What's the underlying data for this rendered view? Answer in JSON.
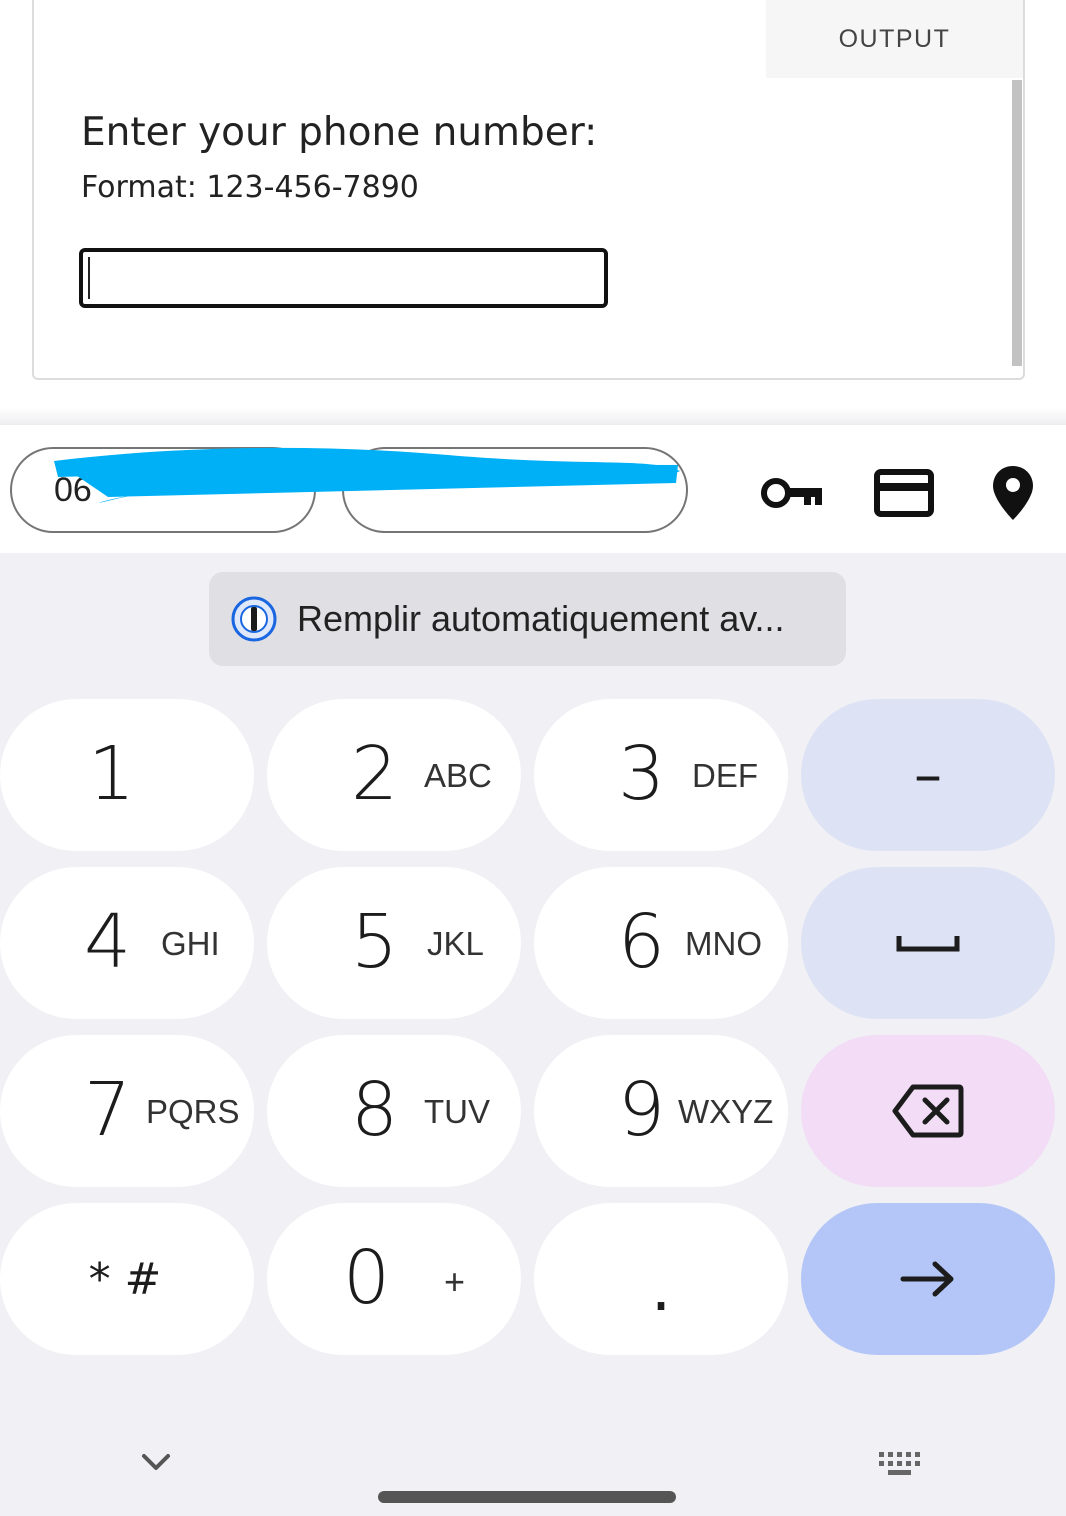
{
  "output": {
    "tab_label": "OUTPUT",
    "prompt": "Enter your phone number:",
    "format_hint": "Format: 123-456-7890",
    "input_value": ""
  },
  "suggestions": {
    "chip_1": "06",
    "chip_2": "",
    "icons": [
      "key-icon",
      "credit-card-icon",
      "location-pin-icon"
    ]
  },
  "autofill": {
    "label": "Remplir automatiquement av..."
  },
  "keys": [
    {
      "num": "1",
      "letters": ""
    },
    {
      "num": "2",
      "letters": "ABC"
    },
    {
      "num": "3",
      "letters": "DEF"
    },
    {
      "num": "4",
      "letters": "GHI"
    },
    {
      "num": "5",
      "letters": "JKL"
    },
    {
      "num": "6",
      "letters": "MNO"
    },
    {
      "num": "7",
      "letters": "PQRS"
    },
    {
      "num": "8",
      "letters": "TUV"
    },
    {
      "num": "9",
      "letters": "WXYZ"
    },
    {
      "num": "* #",
      "letters": ""
    },
    {
      "num": "0",
      "letters": "+"
    },
    {
      "num": ".",
      "letters": ""
    }
  ],
  "fn_keys": {
    "dash": "–",
    "space": "space-icon",
    "backspace": "backspace-icon",
    "enter": "arrow-right-icon"
  },
  "colors": {
    "keyboard_bg": "#f0f0f5",
    "key_bg": "#ffffff",
    "fn_key_bg": "#dde2f5",
    "delete_key_bg": "#f3dcf6",
    "enter_key_bg": "#b3c6f7",
    "redaction": "#00b0f6"
  }
}
